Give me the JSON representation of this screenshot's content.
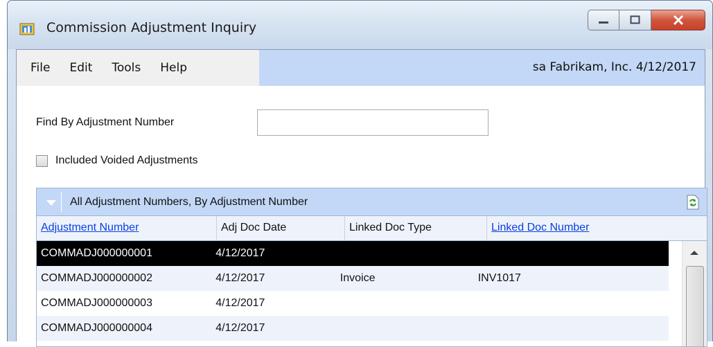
{
  "window": {
    "title": "Commission Adjustment Inquiry"
  },
  "menu": {
    "items": [
      "File",
      "Edit",
      "Tools",
      "Help"
    ],
    "status": "sa  Fabrikam, Inc.  4/12/2017"
  },
  "form": {
    "find_label": "Find By Adjustment Number",
    "find_value": "",
    "include_voided_label": "Included Voided Adjustments",
    "include_voided_checked": false
  },
  "grid": {
    "title": "All Adjustment Numbers, By Adjustment Number",
    "columns": [
      "Adjustment Number",
      "Adj Doc Date",
      "Linked Doc Type",
      "Linked Doc Number"
    ],
    "rows": [
      {
        "number": "COMMADJ000000001",
        "date": "4/12/2017",
        "type": "",
        "doc": ""
      },
      {
        "number": "COMMADJ000000002",
        "date": "4/12/2017",
        "type": "Invoice",
        "doc": "INV1017"
      },
      {
        "number": "COMMADJ000000003",
        "date": "4/12/2017",
        "type": "",
        "doc": ""
      },
      {
        "number": "COMMADJ000000004",
        "date": "4/12/2017",
        "type": "",
        "doc": ""
      }
    ]
  },
  "icons": {
    "app": "commission-app-icon",
    "refresh": "refresh-icon",
    "collapse": "collapse-arrow-icon"
  },
  "colors": {
    "accent_bar": "#c3d8f7",
    "link": "#0b3ee0",
    "selected_row": "#000000"
  }
}
